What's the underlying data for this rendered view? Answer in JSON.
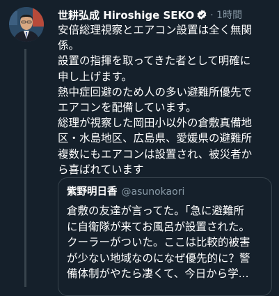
{
  "tweet": {
    "author_name": "世耕弘成 Hiroshige SEKO",
    "time": "· 1時間",
    "lines": [
      "安倍総理視察とエアコン設置は全く無関",
      "係。",
      "設置の指揮を取ってきた者として明確に",
      "申し上げます。",
      "熱中症回避のため人の多い避難所優先で",
      "エアコンを配備しています。",
      "総理が視察した岡田小以外の倉敷真備地",
      "区・水島地区、広島県、愛媛県の避難所",
      "複数にもエアコンは設置され、被災者か",
      "ら喜ばれています"
    ]
  },
  "quote": {
    "author_name": "紫野明日香",
    "handle": "@asunokaori",
    "lines": [
      "倉敷の友達が言ってた。「急に避難所",
      "に自衛隊が来てお風呂が設置された。",
      "クーラーがついた。ここは比較的被害",
      "が少ない地域なのになぜ優先的に？警",
      "備体制がやたら凄くて、今日から学..."
    ]
  },
  "colors": {
    "background": "#15202b",
    "text": "#ffffff",
    "secondary": "#8899a6",
    "border": "#38444d",
    "verified": "#1da1f2"
  },
  "icons": {
    "verified": "verified-badge-icon",
    "avatar": "profile-photo"
  }
}
